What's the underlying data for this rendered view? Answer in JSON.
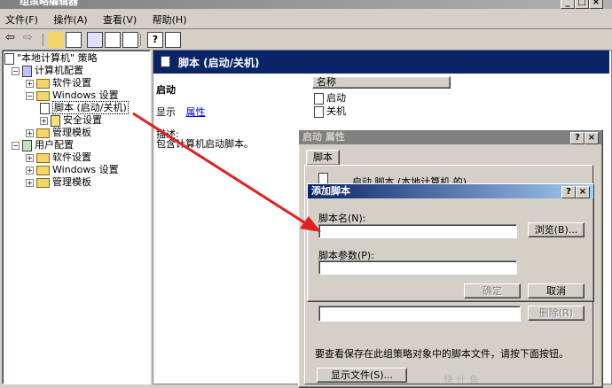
{
  "window": {
    "title": "组策略编辑器"
  },
  "menu": [
    "文件(F)",
    "操作(A)",
    "查看(V)",
    "帮助(H)"
  ],
  "tree": {
    "root": "\"本地计算机\" 策略",
    "computer": "计算机配置",
    "software1": "软件设置",
    "windows1": "Windows 设置",
    "script": "脚本 (启动/关机)",
    "security": "安全设置",
    "admin1": "管理模板",
    "user": "用户配置",
    "software2": "软件设置",
    "windows2": "Windows 设置",
    "admin2": "管理模板"
  },
  "main": {
    "header": "脚本 (启动/关机)",
    "section_title": "启动",
    "display_label": "显示",
    "properties_link": "属性",
    "description_label": "描述:",
    "description_text": "包含计算机启动脚本。",
    "list_header": "名称",
    "list_items": [
      "启动",
      "关机"
    ]
  },
  "props_dialog": {
    "title": "启动 属性",
    "help": "?",
    "close": "×",
    "tab": "脚本",
    "partial_text": "启动 脚本 (本地计算机 的)",
    "remove_button": "删除(R)",
    "info_text": "要查看保存在此组策略对象中的脚本文件，请按下面按钮。",
    "show_files_button": "显示文件(S)..."
  },
  "add_dialog": {
    "title": "添加脚本",
    "help": "?",
    "close": "×",
    "script_name_label": "脚本名(N):",
    "script_name_value": "",
    "browse_button": "浏览(B)...",
    "script_params_label": "脚本参数(P):",
    "script_params_value": "",
    "ok_button": "确定",
    "cancel_button": "取消"
  },
  "watermark": "快 什 鱼",
  "colors": {
    "active_title": "#0a246a",
    "inactive_title": "#808080",
    "arrow": "#e02020"
  }
}
